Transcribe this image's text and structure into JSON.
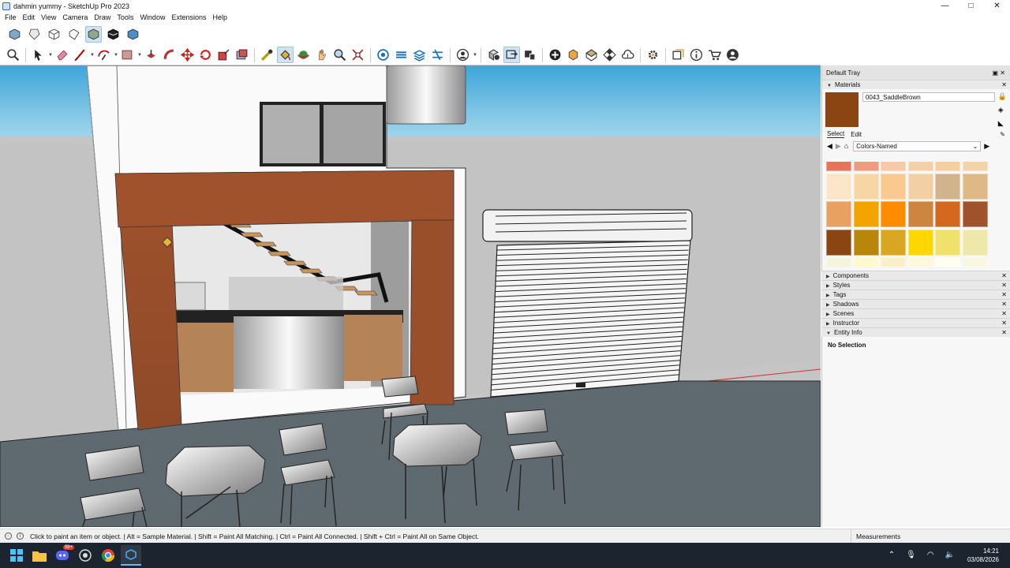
{
  "window": {
    "title": "dahmin yummy - SketchUp Pro 2023",
    "controls": [
      "—",
      "□",
      "✕"
    ]
  },
  "menu": [
    "File",
    "Edit",
    "View",
    "Camera",
    "Draw",
    "Tools",
    "Window",
    "Extensions",
    "Help"
  ],
  "toolbar_views": [
    "iso-view-icon",
    "top-view-icon",
    "front-view-icon",
    "right-view-icon",
    "back-view-icon",
    "left-view-icon",
    "bottom-view-icon"
  ],
  "tray": {
    "title": "Default Tray",
    "materials": {
      "header": "Materials",
      "current_name": "0043_SaddleBrown",
      "current_color": "#8B4513",
      "tabs": [
        "Select",
        "Edit"
      ],
      "library": "Colors-Named",
      "swatches": [
        "#E8735A",
        "#F09A80",
        "#F7C9A6",
        "#F5CFA8",
        "#F7CE9E",
        "#F5D3A8",
        "#FCE5C9",
        "#F7D6A6",
        "#F9C990",
        "#F2D0A4",
        "#D2B48C",
        "#DEB887",
        "#E9A063",
        "#F4A400",
        "#FF8C00",
        "#CD853F",
        "#D2691E",
        "#A0522D",
        "#8B4513",
        "#B8860B",
        "#DAA520",
        "#FFD700",
        "#EEE26C",
        "#EEE8AA",
        "#F5F5DC",
        "#FFFACD",
        "#FAF0C8",
        "#FFF8DC",
        "#FFFFF0",
        "#F8F8E0"
      ]
    },
    "panels": [
      "Components",
      "Styles",
      "Tags",
      "Shadows",
      "Scenes",
      "Instructor",
      "Entity Info"
    ],
    "entity_info": "No Selection"
  },
  "status": {
    "message": "Click to paint an item or object. | Alt = Sample Material. | Shift = Paint All Matching. | Ctrl = Paint All Connected. | Shift + Ctrl = Paint All on Same Object.",
    "measurements_label": "Measurements"
  },
  "taskbar": {
    "time": "14:21",
    "date": "03/08/2026",
    "badge": "99+"
  }
}
